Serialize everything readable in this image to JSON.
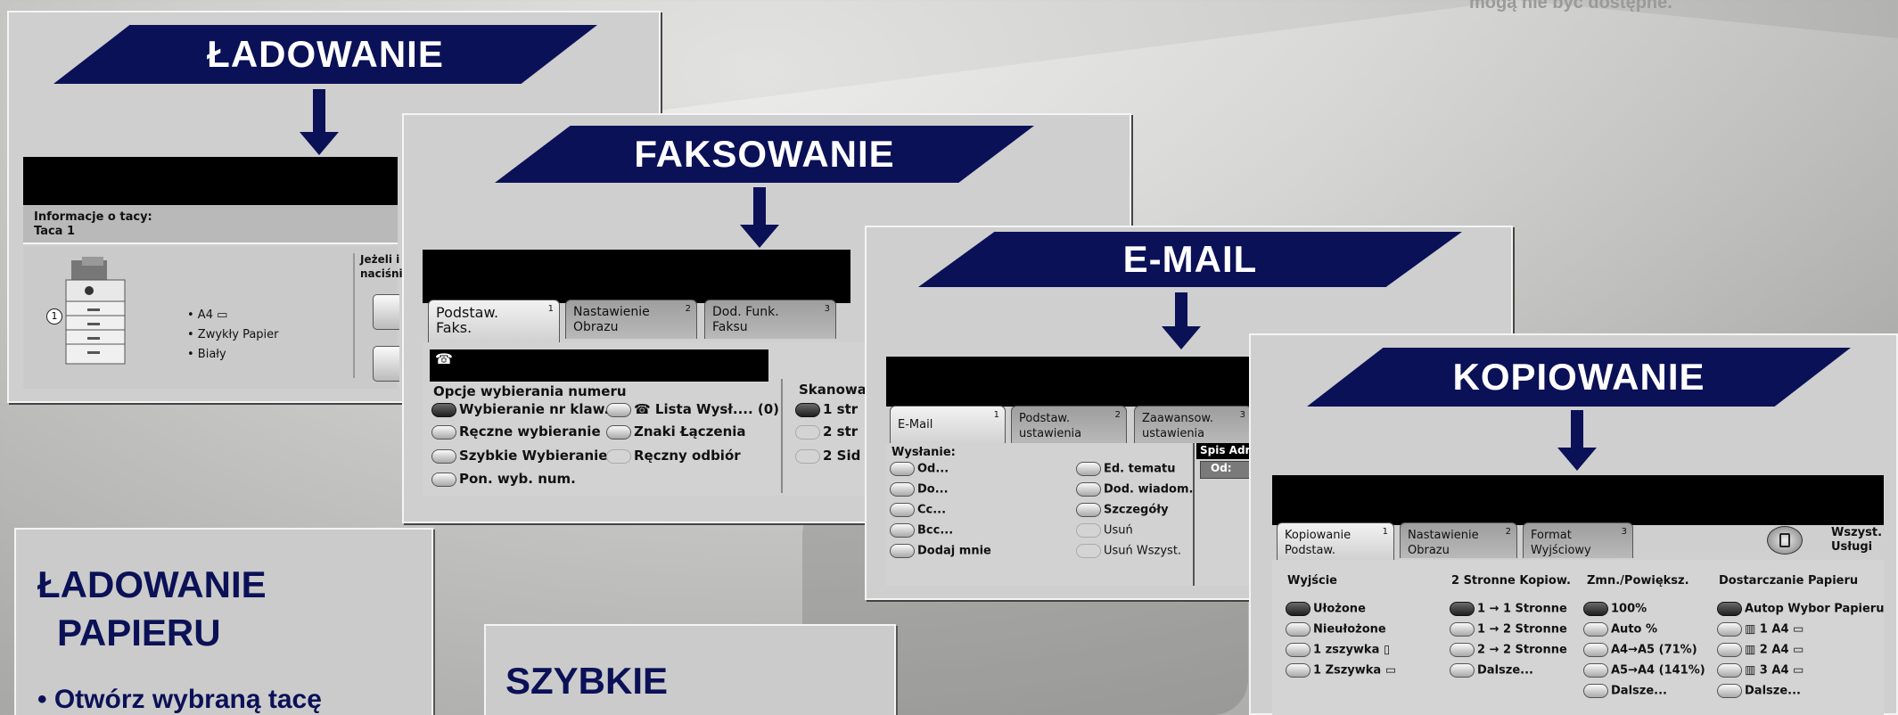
{
  "corner_note": "mogą nie być dostępne.",
  "ladowanie": {
    "banner": "ŁADOWANIE",
    "info_label": "Informacje o tacy:",
    "tray": "Taca 1",
    "specs": [
      "• A4 ▭",
      "• Zwykły Papier",
      "• Biały"
    ],
    "note_line1": "Jeżeli i",
    "note_line2": "naciśni",
    "callout": "1"
  },
  "fax": {
    "banner": "FAKSOWANIE",
    "tabs": [
      {
        "label1": "Podstaw.",
        "label2": "Faks.",
        "num": "1"
      },
      {
        "label1": "Nastawienie",
        "label2": "Obrazu",
        "num": "2"
      },
      {
        "label1": "Dod. Funk.",
        "label2": "Faksu",
        "num": "3"
      }
    ],
    "phone_icon": "☎",
    "dial_title": "Opcje wybierania numeru",
    "scan_title": "Skanowan",
    "options": [
      "Wybieranie nr klaw.",
      "Ręczne wybieranie",
      "Szybkie Wybieranie",
      "Pon. wyb. num."
    ],
    "options2": [
      "☎ Lista Wysł.... (0)",
      "Znaki Łączenia",
      "Ręczny odbiór"
    ],
    "scan": [
      "1 str",
      "2 str",
      "2 Sid"
    ]
  },
  "email": {
    "banner": "E-MAIL",
    "tabs": [
      {
        "label1": "E-Mail",
        "label2": "",
        "num": "1"
      },
      {
        "label1": "Podstaw.",
        "label2": "ustawienia",
        "num": "2"
      },
      {
        "label1": "Zaawansow.",
        "label2": "ustawienia",
        "num": "3"
      }
    ],
    "send_label": "Wysłanie:",
    "left": [
      "Od...",
      "Do...",
      "Cc...",
      "Bcc...",
      "Dodaj mnie"
    ],
    "right": [
      "Ed. tematu",
      "Dod. wiadom.",
      "Szczegóły",
      "Usuń",
      "Usuń Wszyst."
    ],
    "addr_title": "Spis Adr",
    "addr_from": "Od:"
  },
  "kopiowanie": {
    "banner": "KOPIOWANIE",
    "tabs": [
      {
        "label1": "Kopiowanie",
        "label2": "Podstaw.",
        "num": "1"
      },
      {
        "label1": "Nastawienie",
        "label2": "Obrazu",
        "num": "2"
      },
      {
        "label1": "Format",
        "label2": "Wyjściowy",
        "num": "3"
      }
    ],
    "all_services1": "Wszyst.",
    "all_services2": "Usługi",
    "col_headers": [
      "Wyjście",
      "2 Stronne Kopiow.",
      "Zmn./Powiększ.",
      "Dostarczanie Papieru"
    ],
    "output": [
      "Ułożone",
      "Nieułożone",
      "1 zszywka ▯",
      "1 Zszywka ▭"
    ],
    "duplex": [
      "1 → 1 Stronne",
      "1 → 2 Stronne",
      "2 → 2 Stronne",
      "Dalsze..."
    ],
    "reduce": [
      "100%",
      "Auto %",
      "A4→A5 (71%)",
      "A5→A4 (141%)",
      "Dalsze..."
    ],
    "paper": [
      "Autop Wybor Papieru",
      "▥ 1 A4 ▭",
      "▥ 2 A4 ▭",
      "▥ 3 A4 ▭",
      "Dalsze..."
    ]
  },
  "box_paper": {
    "title1": "ŁADOWANIE",
    "title2": "PAPIERU",
    "bullet": "• Otwórz wybraną tacę"
  },
  "box_quick": {
    "title": "SZYBKIE"
  },
  "colors": {
    "banner": "#0b1157",
    "panel": "#cfcfcf"
  }
}
